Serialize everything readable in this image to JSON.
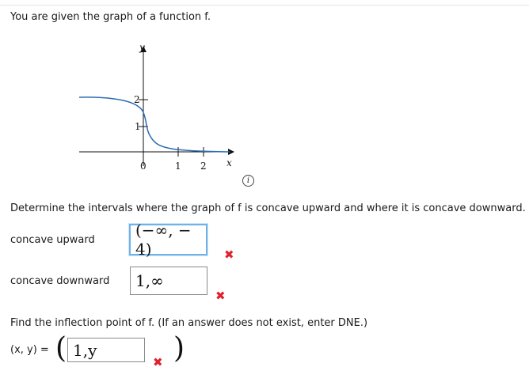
{
  "problem": {
    "intro": "You are given the graph of a function f.",
    "graph": {
      "y_axis_label": "y",
      "x_axis_label": "x",
      "y_ticks": [
        "2",
        "1"
      ],
      "x_ticks": [
        "1",
        "2"
      ],
      "origin_label": "0",
      "curve_color": "#2b6cb0"
    },
    "info_icon": "info-icon",
    "question_concavity": "Determine the intervals where the graph of f is concave upward and where it is concave downward.",
    "concave_upward": {
      "label": "concave upward",
      "value": "(−∞, − 4)",
      "status": "incorrect"
    },
    "concave_downward": {
      "label": "concave downward",
      "value": "1,∞",
      "status": "incorrect"
    },
    "question_inflection": "Find the inflection point of f. (If an answer does not exist, enter DNE.)",
    "inflection": {
      "label": "(x, y) =",
      "open_paren": "(",
      "close_paren": ")",
      "value": "1,y",
      "status": "incorrect"
    },
    "incorrect_mark": "✖"
  }
}
